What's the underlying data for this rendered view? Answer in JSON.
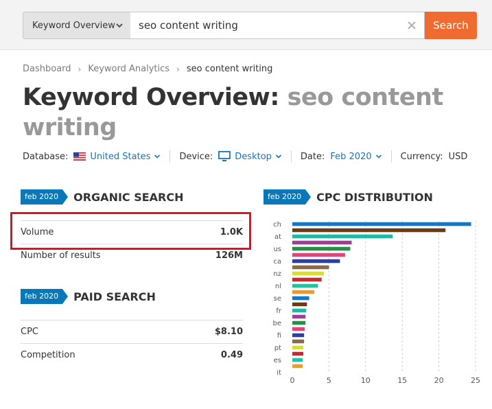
{
  "search": {
    "selector_label": "Keyword Overview",
    "query": "seo content writing",
    "button_label": "Search"
  },
  "breadcrumb": [
    "Dashboard",
    "Keyword Analytics",
    "seo content writing"
  ],
  "title": {
    "prefix": "Keyword Overview:",
    "keyword": "seo content writing"
  },
  "filters": {
    "database_label": "Database:",
    "database_value": "United States",
    "device_label": "Device:",
    "device_value": "Desktop",
    "date_label": "Date:",
    "date_value": "Feb 2020",
    "currency_label": "Currency:",
    "currency_value": "USD"
  },
  "organic": {
    "badge": "feb 2020",
    "title": "ORGANIC SEARCH",
    "rows": [
      {
        "label": "Volume",
        "value": "1.0K"
      },
      {
        "label": "Number of results",
        "value": "126M"
      }
    ]
  },
  "paid": {
    "badge": "feb 2020",
    "title": "PAID SEARCH",
    "rows": [
      {
        "label": "CPC",
        "value": "$8.10"
      },
      {
        "label": "Competition",
        "value": "0.49"
      }
    ]
  },
  "cpc": {
    "badge": "feb 2020",
    "title": "CPC DISTRIBUTION"
  },
  "chart_data": {
    "type": "bar",
    "orientation": "horizontal",
    "categories": [
      "ch",
      "at",
      "us",
      "ca",
      "nz",
      "nl",
      "se",
      "fr",
      "be",
      "fi",
      "pt",
      "es",
      "it"
    ],
    "values": [
      24.4,
      20.9,
      13.7,
      8.1,
      7.9,
      7.2,
      6.5,
      5.0,
      4.3,
      4.0,
      3.5,
      3.0,
      2.3,
      2.0,
      1.9,
      1.8,
      1.8,
      1.7,
      1.6,
      1.6,
      1.5,
      1.5,
      1.4,
      1.4
    ],
    "colors": [
      "#1a76c2",
      "#6b3a12",
      "#22b8a8",
      "#a23d9b",
      "#2e8c4a",
      "#e8407a",
      "#2f3f9e",
      "#8a6a48",
      "#d8dc3c",
      "#c8282e",
      "#28c0a0",
      "#f09a2a",
      "#1a76c2",
      "#6b3a12",
      "#22b8a8",
      "#a23d9b",
      "#2e8c4a",
      "#e8407a",
      "#2f3f9e",
      "#8a6a48",
      "#d8dc3c",
      "#c8282e",
      "#28c0a0",
      "#f09a2a"
    ],
    "xlim": [
      0,
      25
    ],
    "xticks": [
      0,
      5,
      10,
      15,
      20,
      25
    ],
    "grid": true
  }
}
